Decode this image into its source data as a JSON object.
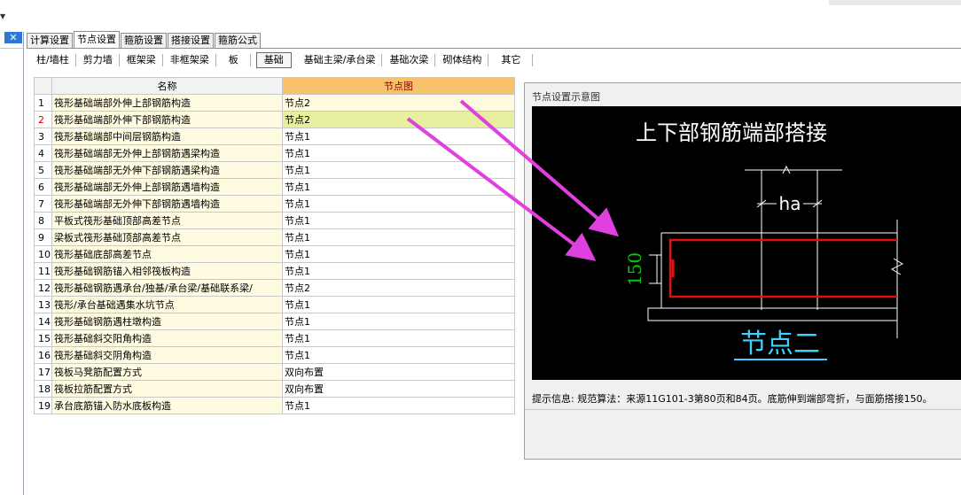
{
  "tabs": [
    {
      "label": "计算设置",
      "active": false
    },
    {
      "label": "节点设置",
      "active": true
    },
    {
      "label": "箍筋设置",
      "active": false
    },
    {
      "label": "搭接设置",
      "active": false
    },
    {
      "label": "箍筋公式",
      "active": false
    }
  ],
  "toolbar": [
    {
      "label": "柱/墙柱",
      "active": false
    },
    {
      "label": "剪力墙",
      "active": false
    },
    {
      "label": "框架梁",
      "active": false
    },
    {
      "label": "非框架梁",
      "active": false
    },
    {
      "label": "板",
      "active": false
    },
    {
      "label": "基础",
      "active": true
    },
    {
      "label": "基础主梁/承台梁",
      "active": false
    },
    {
      "label": "基础次梁",
      "active": false
    },
    {
      "label": "砌体结构",
      "active": false
    },
    {
      "label": "其它",
      "active": false
    }
  ],
  "grid": {
    "headers": {
      "name": "名称",
      "value": "节点图"
    },
    "rows": [
      {
        "num": "1",
        "name": "筏形基础端部外伸上部钢筋构造",
        "value": "节点2"
      },
      {
        "num": "2",
        "name": "筏形基础端部外伸下部钢筋构造",
        "value": "节点2"
      },
      {
        "num": "3",
        "name": "筏形基础端部中间层钢筋构造",
        "value": "节点1"
      },
      {
        "num": "4",
        "name": "筏形基础端部无外伸上部钢筋遇梁构造",
        "value": "节点1"
      },
      {
        "num": "5",
        "name": "筏形基础端部无外伸下部钢筋遇梁构造",
        "value": "节点1"
      },
      {
        "num": "6",
        "name": "筏形基础端部无外伸上部钢筋遇墙构造",
        "value": "节点1"
      },
      {
        "num": "7",
        "name": "筏形基础端部无外伸下部钢筋遇墙构造",
        "value": "节点1"
      },
      {
        "num": "8",
        "name": "平板式筏形基础顶部高差节点",
        "value": "节点1"
      },
      {
        "num": "9",
        "name": "梁板式筏形基础顶部高差节点",
        "value": "节点1"
      },
      {
        "num": "10",
        "name": "筏形基础底部高差节点",
        "value": "节点1"
      },
      {
        "num": "11",
        "name": "筏形基础钢筋锚入相邻筏板构造",
        "value": "节点1"
      },
      {
        "num": "12",
        "name": "筏形基础钢筋遇承台/独基/承台梁/基础联系梁/",
        "value": "节点2"
      },
      {
        "num": "13",
        "name": "筏形/承台基础遇集水坑节点",
        "value": "节点1"
      },
      {
        "num": "14",
        "name": "筏形基础钢筋遇柱墩构造",
        "value": "节点1"
      },
      {
        "num": "15",
        "name": "筏形基础斜交阳角构造",
        "value": "节点1"
      },
      {
        "num": "16",
        "name": "筏形基础斜交阴角构造",
        "value": "节点1"
      },
      {
        "num": "17",
        "name": "筏板马凳筋配置方式",
        "value": "双向布置"
      },
      {
        "num": "18",
        "name": "筏板拉筋配置方式",
        "value": "双向布置"
      },
      {
        "num": "19",
        "name": "承台底筋锚入防水底板构造",
        "value": "节点1"
      }
    ]
  },
  "diagram": {
    "panel_title": "节点设置示意图",
    "heading": "上下部钢筋端部搭接",
    "dim_ha": "ha",
    "dim_150": "150",
    "node_label": "节点二",
    "hint": "提示信息:  规范算法：来源11G101-3第80页和84页。底筋伸到端部弯折，与面筋搭接150。"
  },
  "colors": {
    "header_highlight": "#f7c26a",
    "rebar": "#e01010",
    "dimension_green": "#00d000",
    "node_label_cyan": "#40d0ff",
    "annotation_arrow": "#e040e0"
  }
}
